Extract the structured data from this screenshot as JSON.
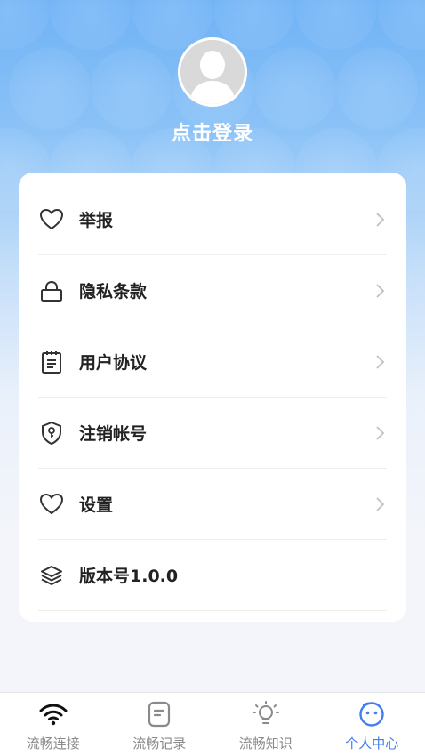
{
  "profile": {
    "login_label": "点击登录"
  },
  "menu": {
    "items": [
      {
        "label": "举报",
        "icon": "heart-icon"
      },
      {
        "label": "隐私条款",
        "icon": "lock-icon"
      },
      {
        "label": "用户协议",
        "icon": "clipboard-icon"
      },
      {
        "label": "注销帐号",
        "icon": "shield-key-icon"
      },
      {
        "label": "设置",
        "icon": "heart-icon"
      },
      {
        "label": "版本号1.0.0",
        "icon": "layers-icon"
      }
    ]
  },
  "tabbar": {
    "tabs": [
      {
        "label": "流畅连接",
        "icon": "wifi-icon"
      },
      {
        "label": "流畅记录",
        "icon": "note-icon"
      },
      {
        "label": "流畅知识",
        "icon": "bulb-icon"
      },
      {
        "label": "个人中心",
        "icon": "smile-face-icon"
      }
    ],
    "active_index": 3
  },
  "colors": {
    "accent": "#3f7df0",
    "header_top": "#6fb2f6"
  }
}
